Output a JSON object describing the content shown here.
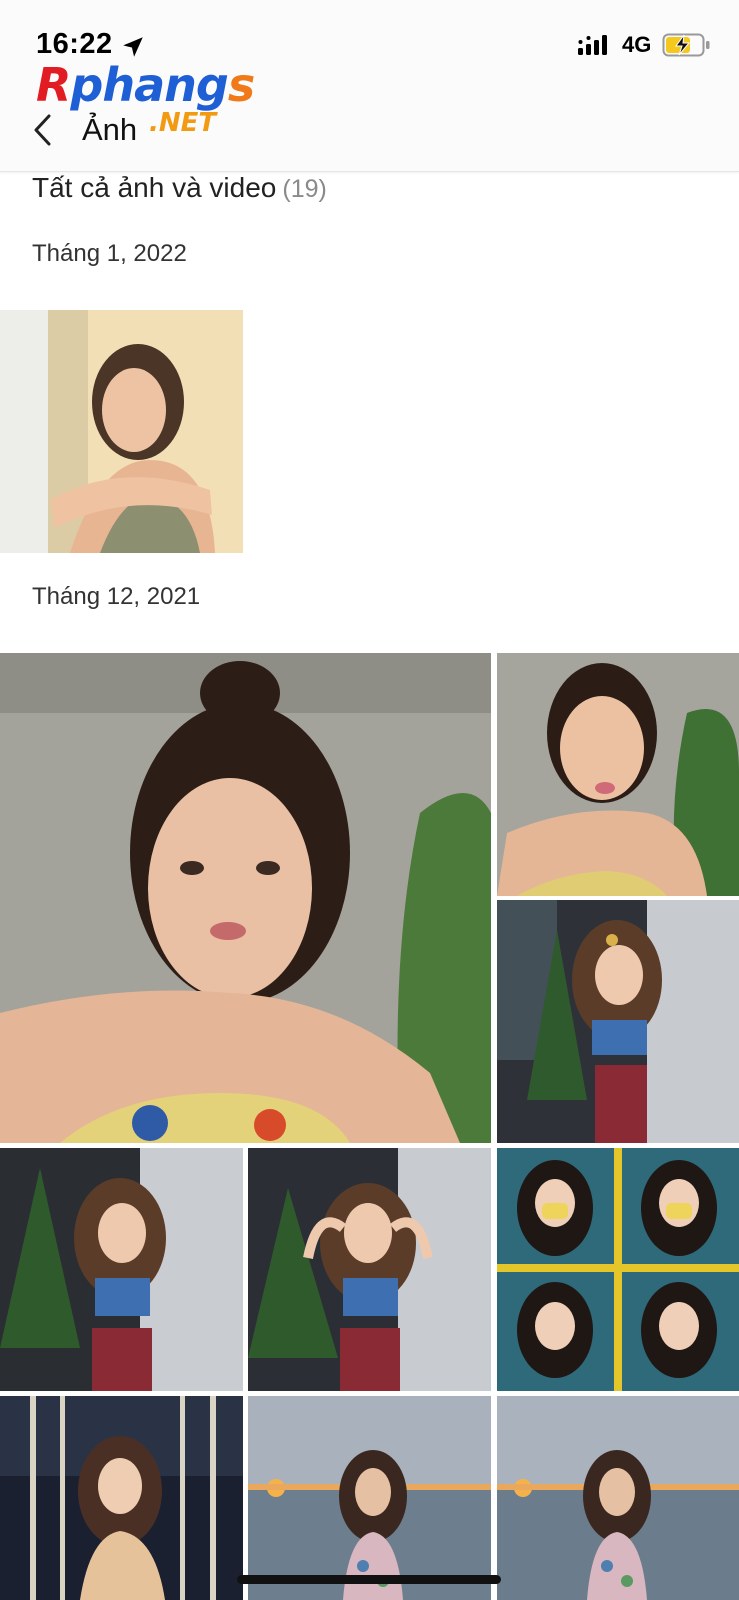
{
  "status_bar": {
    "time": "16:22",
    "network": "4G",
    "icons": [
      "location-arrow-icon",
      "signal-icon",
      "battery-charging-icon"
    ]
  },
  "watermark": {
    "brand_first_letter": "R",
    "brand_middle": "phang",
    "brand_last_letter": "s",
    "brand_suffix": ".NET",
    "colors": {
      "red": "#e21c23",
      "blue": "#1f5fd6",
      "orange": "#f07a1a"
    }
  },
  "nav": {
    "back_icon": "chevron-left-icon",
    "title": "Ảnh"
  },
  "gallery": {
    "heading": "Tất cả ảnh và video",
    "count": "(19)",
    "groups": [
      {
        "month": "Tháng 1, 2022"
      },
      {
        "month": "Tháng 12, 2021"
      }
    ]
  }
}
